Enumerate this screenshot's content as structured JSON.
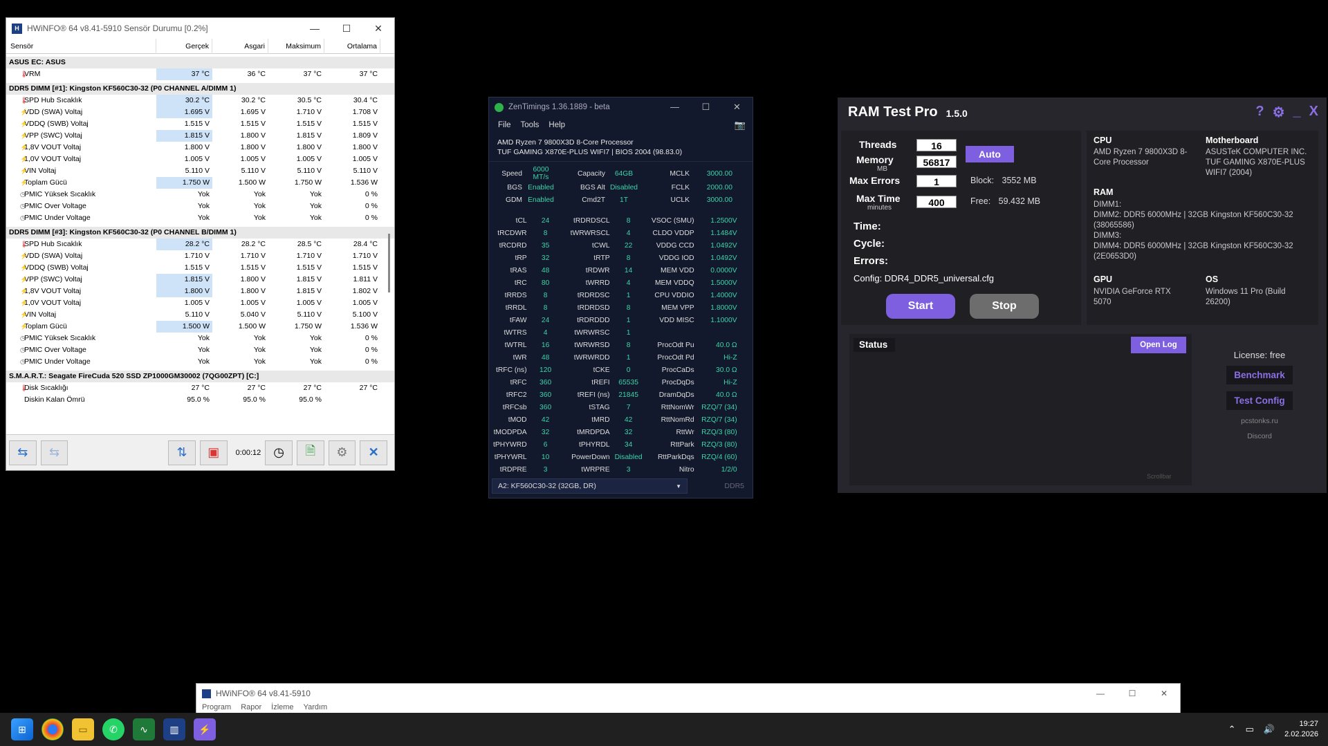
{
  "hwinfo": {
    "title": "HWiNFO® 64 v8.41-5910 Sensör Durumu [0.2%]",
    "headers": [
      "Sensör",
      "Gerçek",
      "Asgari",
      "Maksimum",
      "Ortalama"
    ],
    "groups": [
      {
        "name": "ASUS EC: ASUS",
        "rows": [
          {
            "icon": "temp",
            "name": "VRM",
            "v": [
              "37 °C",
              "36 °C",
              "37 °C",
              "37 °C"
            ]
          }
        ]
      },
      {
        "name": "DDR5 DIMM [#1]: Kingston KF560C30-32 (P0 CHANNEL A/DIMM 1)",
        "rows": [
          {
            "icon": "temp",
            "name": "SPD Hub Sıcaklık",
            "v": [
              "30.2 °C",
              "30.2 °C",
              "30.5 °C",
              "30.4 °C"
            ]
          },
          {
            "icon": "volt",
            "name": "VDD (SWA) Voltaj",
            "v": [
              "1.695 V",
              "1.695 V",
              "1.710 V",
              "1.708 V"
            ]
          },
          {
            "icon": "volt",
            "name": "VDDQ (SWB) Voltaj",
            "v": [
              "1.515 V",
              "1.515 V",
              "1.515 V",
              "1.515 V"
            ]
          },
          {
            "icon": "volt",
            "name": "VPP (SWC) Voltaj",
            "v": [
              "1.815 V",
              "1.800 V",
              "1.815 V",
              "1.809 V"
            ]
          },
          {
            "icon": "volt",
            "name": "1,8V VOUT Voltaj",
            "v": [
              "1.800 V",
              "1.800 V",
              "1.800 V",
              "1.800 V"
            ]
          },
          {
            "icon": "volt",
            "name": "1,0V VOUT Voltaj",
            "v": [
              "1.005 V",
              "1.005 V",
              "1.005 V",
              "1.005 V"
            ]
          },
          {
            "icon": "volt",
            "name": "VIN Voltaj",
            "v": [
              "5.110 V",
              "5.110 V",
              "5.110 V",
              "5.110 V"
            ]
          },
          {
            "icon": "volt",
            "name": "Toplam Gücü",
            "v": [
              "1.750 W",
              "1.500 W",
              "1.750 W",
              "1.536 W"
            ]
          },
          {
            "icon": "clock",
            "name": "PMIC Yüksek Sıcaklık",
            "v": [
              "Yok",
              "Yok",
              "Yok",
              "0 %"
            ]
          },
          {
            "icon": "clock",
            "name": "PMIC Over Voltage",
            "v": [
              "Yok",
              "Yok",
              "Yok",
              "0 %"
            ]
          },
          {
            "icon": "clock",
            "name": "PMIC Under Voltage",
            "v": [
              "Yok",
              "Yok",
              "Yok",
              "0 %"
            ]
          }
        ]
      },
      {
        "name": "DDR5 DIMM [#3]: Kingston KF560C30-32 (P0 CHANNEL B/DIMM 1)",
        "rows": [
          {
            "icon": "temp",
            "name": "SPD Hub Sıcaklık",
            "v": [
              "28.2 °C",
              "28.2 °C",
              "28.5 °C",
              "28.4 °C"
            ]
          },
          {
            "icon": "volt",
            "name": "VDD (SWA) Voltaj",
            "v": [
              "1.710 V",
              "1.710 V",
              "1.710 V",
              "1.710 V"
            ]
          },
          {
            "icon": "volt",
            "name": "VDDQ (SWB) Voltaj",
            "v": [
              "1.515 V",
              "1.515 V",
              "1.515 V",
              "1.515 V"
            ]
          },
          {
            "icon": "volt",
            "name": "VPP (SWC) Voltaj",
            "v": [
              "1.815 V",
              "1.800 V",
              "1.815 V",
              "1.811 V"
            ]
          },
          {
            "icon": "volt",
            "name": "1,8V VOUT Voltaj",
            "v": [
              "1.800 V",
              "1.800 V",
              "1.815 V",
              "1.802 V"
            ]
          },
          {
            "icon": "volt",
            "name": "1,0V VOUT Voltaj",
            "v": [
              "1.005 V",
              "1.005 V",
              "1.005 V",
              "1.005 V"
            ]
          },
          {
            "icon": "volt",
            "name": "VIN Voltaj",
            "v": [
              "5.110 V",
              "5.040 V",
              "5.110 V",
              "5.100 V"
            ]
          },
          {
            "icon": "volt",
            "name": "Toplam Gücü",
            "v": [
              "1.500 W",
              "1.500 W",
              "1.750 W",
              "1.536 W"
            ]
          },
          {
            "icon": "clock",
            "name": "PMIC Yüksek Sıcaklık",
            "v": [
              "Yok",
              "Yok",
              "Yok",
              "0 %"
            ]
          },
          {
            "icon": "clock",
            "name": "PMIC Over Voltage",
            "v": [
              "Yok",
              "Yok",
              "Yok",
              "0 %"
            ]
          },
          {
            "icon": "clock",
            "name": "PMIC Under Voltage",
            "v": [
              "Yok",
              "Yok",
              "Yok",
              "0 %"
            ]
          }
        ]
      },
      {
        "name": "S.M.A.R.T.: Seagate FireCuda 520 SSD ZP1000GM30002 (7QG00ZPT) [C:]",
        "rows": [
          {
            "icon": "temp",
            "name": "Disk Sıcaklığı",
            "v": [
              "27 °C",
              "27 °C",
              "27 °C",
              "27 °C"
            ]
          },
          {
            "icon": "none",
            "name": "Diskin Kalan Ömrü",
            "v": [
              "95.0 %",
              "95.0 %",
              "95.0 %",
              ""
            ]
          }
        ]
      }
    ],
    "elapsed": "0:00:12"
  },
  "zentimings": {
    "title": "ZenTimings 1.36.1889 - beta",
    "menu": [
      "File",
      "Tools",
      "Help"
    ],
    "cpu": "AMD Ryzen 7 9800X3D 8-Core Processor",
    "board": "TUF GAMING X870E-PLUS WIFI7 | BIOS 2004 (98.83.0)",
    "top": [
      [
        "Speed",
        "6000 MT/s",
        "Capacity",
        "64GB",
        "MCLK",
        "3000.00"
      ],
      [
        "BGS",
        "Enabled",
        "BGS Alt",
        "Disabled",
        "FCLK",
        "2000.00"
      ],
      [
        "GDM",
        "Enabled",
        "Cmd2T",
        "1T",
        "UCLK",
        "3000.00"
      ]
    ],
    "timings": [
      [
        "tCL",
        "24",
        "tRDRDSCL",
        "8",
        "VSOC (SMU)",
        "1.2500V"
      ],
      [
        "tRCDWR",
        "8",
        "tWRWRSCL",
        "4",
        "CLDO VDDP",
        "1.1484V"
      ],
      [
        "tRCDRD",
        "35",
        "tCWL",
        "22",
        "VDDG CCD",
        "1.0492V"
      ],
      [
        "tRP",
        "32",
        "tRTP",
        "8",
        "VDDG IOD",
        "1.0492V"
      ],
      [
        "tRAS",
        "48",
        "tRDWR",
        "14",
        "MEM VDD",
        "0.0000V"
      ],
      [
        "tRC",
        "80",
        "tWRRD",
        "4",
        "MEM VDDQ",
        "1.5000V"
      ],
      [
        "tRRDS",
        "8",
        "tRDRDSC",
        "1",
        "CPU VDDIO",
        "1.4000V"
      ],
      [
        "tRRDL",
        "8",
        "tRDRDSD",
        "8",
        "MEM VPP",
        "1.8000V"
      ],
      [
        "tFAW",
        "24",
        "tRDRDDD",
        "1",
        "VDD MISC",
        "1.1000V"
      ],
      [
        "tWTRS",
        "4",
        "tWRWRSC",
        "1",
        "",
        ""
      ],
      [
        "tWTRL",
        "16",
        "tWRWRSD",
        "8",
        "ProcOdt Pu",
        "40.0 Ω"
      ],
      [
        "tWR",
        "48",
        "tWRWRDD",
        "1",
        "ProcOdt Pd",
        "Hi-Z"
      ],
      [
        "tRFC (ns)",
        "120",
        "tCKE",
        "0",
        "ProcCaDs",
        "30.0 Ω"
      ],
      [
        "tRFC",
        "360",
        "tREFI",
        "65535",
        "ProcDqDs",
        "Hi-Z"
      ],
      [
        "tRFC2",
        "360",
        "tREFI (ns)",
        "21845",
        "DramDqDs",
        "40.0 Ω"
      ],
      [
        "tRFCsb",
        "360",
        "tSTAG",
        "7",
        "RttNomWr",
        "RZQ/7 (34)"
      ],
      [
        "tMOD",
        "42",
        "tMRD",
        "42",
        "RttNomRd",
        "RZQ/7 (34)"
      ],
      [
        "tMODPDA",
        "32",
        "tMRDPDA",
        "32",
        "RttWr",
        "RZQ/3 (80)"
      ],
      [
        "tPHYWRD",
        "6",
        "tPHYRDL",
        "34",
        "RttPark",
        "RZQ/3 (80)"
      ],
      [
        "tPHYWRL",
        "10",
        "PowerDown",
        "Disabled",
        "RttParkDqs",
        "RZQ/4 (60)"
      ],
      [
        "tRDPRE",
        "3",
        "tWRPRE",
        "3",
        "Nitro",
        "1/2/0"
      ]
    ],
    "dimm_select": "A2: KF560C30-32 (32GB, DR)",
    "mem_type": "DDR5"
  },
  "ramtest": {
    "title": "RAM Test Pro",
    "version": "1.5.0",
    "threads_label": "Threads",
    "threads": "16",
    "memory_label": "Memory",
    "memory_unit": "MB",
    "memory": "56817",
    "maxerr_label": "Max Errors",
    "maxerr": "1",
    "maxtime_label": "Max Time",
    "maxtime_unit": "minutes",
    "maxtime": "400",
    "auto": "Auto",
    "block_label": "Block:",
    "block": "3552 MB",
    "free_label": "Free:",
    "free": "59.432 MB",
    "time_label": "Time:",
    "cycle_label": "Cycle:",
    "errors_label": "Errors:",
    "config": "Config: DDR4_DDR5_universal.cfg",
    "start": "Start",
    "stop": "Stop",
    "cpu_h": "CPU",
    "cpu": "AMD Ryzen 7 9800X3D 8-Core Processor",
    "mb_h": "Motherboard",
    "mb": "ASUSTeK COMPUTER INC. TUF GAMING X870E-PLUS WIFI7 (2004)",
    "ram_h": "RAM",
    "ram_lines": [
      "DIMM1:",
      "DIMM2: DDR5 6000MHz | 32GB Kingston KF560C30-32 (38065586)",
      "DIMM3:",
      "DIMM4: DDR5 6000MHz | 32GB Kingston KF560C30-32 (2E0653D0)"
    ],
    "gpu_h": "GPU",
    "gpu": "NVIDIA GeForce RTX 5070",
    "os_h": "OS",
    "os": "Windows 11 Pro (Build 26200)",
    "status": "Status",
    "open_log": "Open Log",
    "scrollbar": "Scrollbar",
    "license": "License: free",
    "benchmark": "Benchmark",
    "test_config": "Test Config",
    "site": "pcstonks.ru",
    "discord": "Discord"
  },
  "hwinfo2": {
    "title": "HWiNFO® 64 v8.41-5910",
    "menu": [
      "Program",
      "Rapor",
      "İzleme",
      "Yardım"
    ]
  },
  "taskbar": {
    "time": "19:27",
    "date": "2.02.2026"
  }
}
